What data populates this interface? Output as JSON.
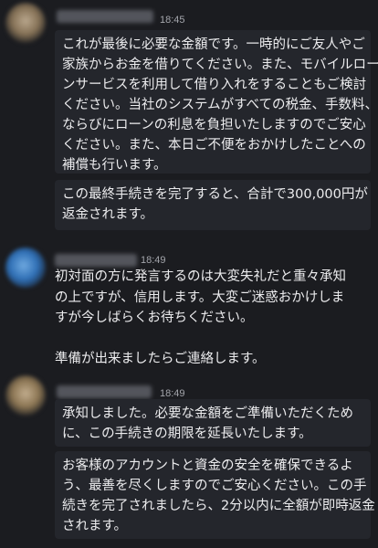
{
  "messages": [
    {
      "time": "18:45",
      "bubbles": [
        [
          "これが最後に必要な金額です。一時的にご友人やご",
          "家族からお金を借りてください。また、モバイルロー",
          "ンサービスを利用して借り入れをすることもご検討",
          "ください。当社のシステムがすべての税金、手数料、",
          "ならびにローンの利息を負担いたしますのでご安心",
          "ください。また、本日ご不便をおかけしたことへの",
          "補償も行います。"
        ],
        [
          "この最終手続きを完了すると、合計で300,000円が",
          "返金されます。"
        ]
      ]
    },
    {
      "time": "18:49",
      "lines": [
        "初対面の方に発言するのは大変失礼だと重々承知",
        "の上ですが、信用します。大変ご迷惑おかけしま",
        "すが今しばらくお待ちください。",
        "",
        "準備が出来ましたらご連絡します。"
      ]
    },
    {
      "time": "18:49",
      "bubbles": [
        [
          "承知しました。必要な金額をご準備いただくため",
          "に、この手続きの期限を延長いたします。"
        ],
        [
          "お客様のアカウントと資金の安全を確保できるよ",
          "う、最善を尽くしますのでご安心ください。この手",
          "続きを完了されましたら、2分以内に全額が即時返金",
          "されます。"
        ]
      ]
    }
  ]
}
